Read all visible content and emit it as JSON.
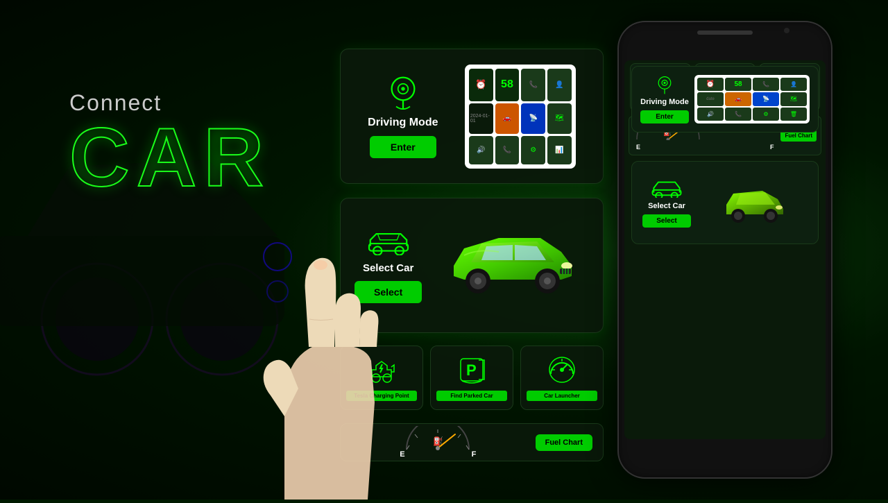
{
  "background": {
    "color": "#001a00"
  },
  "left_text": {
    "connect_label": "Connect",
    "car_label": "CAR"
  },
  "driving_mode": {
    "title": "Driving Mode",
    "enter_button": "Enter",
    "clock_value": "58",
    "app_cells": [
      {
        "label": "📞",
        "type": "phone"
      },
      {
        "label": "👤",
        "type": "contact"
      },
      {
        "label": "🚗",
        "type": "car",
        "style": "orange"
      },
      {
        "label": "📡",
        "type": "bluetooth",
        "style": "blue"
      },
      {
        "label": "🗺",
        "type": "nav"
      },
      {
        "label": "🔊",
        "type": "sound"
      },
      {
        "label": "📞",
        "type": "call"
      },
      {
        "label": "⚙",
        "type": "apps"
      },
      {
        "label": "📊",
        "type": "chart"
      },
      {
        "label": "🗑",
        "type": "trash"
      }
    ]
  },
  "select_car": {
    "title": "Select Car",
    "select_button": "Select"
  },
  "feature_cards": [
    {
      "label": "Tesla Charging Point",
      "icon": "⚡🚗"
    },
    {
      "label": "Find Parked Car",
      "icon": "🅿"
    },
    {
      "label": "Car Launcher",
      "icon": "🎯"
    }
  ],
  "fuel_chart": {
    "e_label": "E",
    "f_label": "F",
    "button_label": "Fuel Chart"
  },
  "phone": {
    "visible": true
  }
}
